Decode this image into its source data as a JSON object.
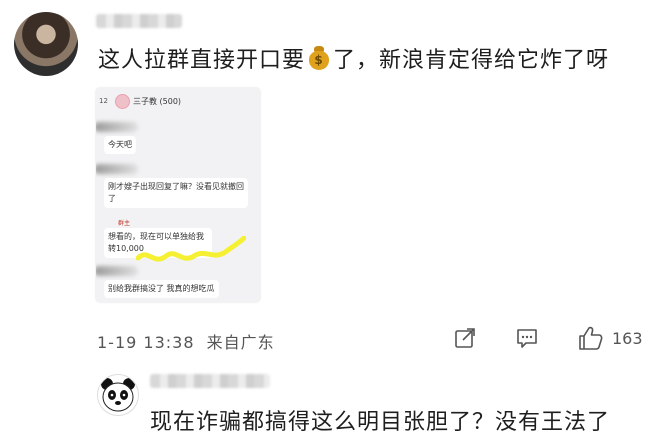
{
  "comment1": {
    "text_before": "这人拉群直接开口要",
    "text_after": "了，新浪肯定得给它炸了呀",
    "emoji": "money-bag-icon",
    "time": "1-19 13:38",
    "source": "来自广东",
    "like_count": "163"
  },
  "screenshot": {
    "header_number": "12",
    "group_name": "三子教 (500)",
    "msg1": "今天吧",
    "msg2": "刚才嫂子出现回复了嘛？没看见就撤回了",
    "sender_tag": "群主",
    "msg3": "想看的，现在可以单独给我转10,000",
    "msg4": "别给我群搞没了 我真的想吃瓜"
  },
  "comment2": {
    "text": "现在诈骗都搞得这么明目张胆了？没有王法了"
  },
  "colors": {
    "squiggle": "#f5f032",
    "link_icon": "#555555"
  }
}
